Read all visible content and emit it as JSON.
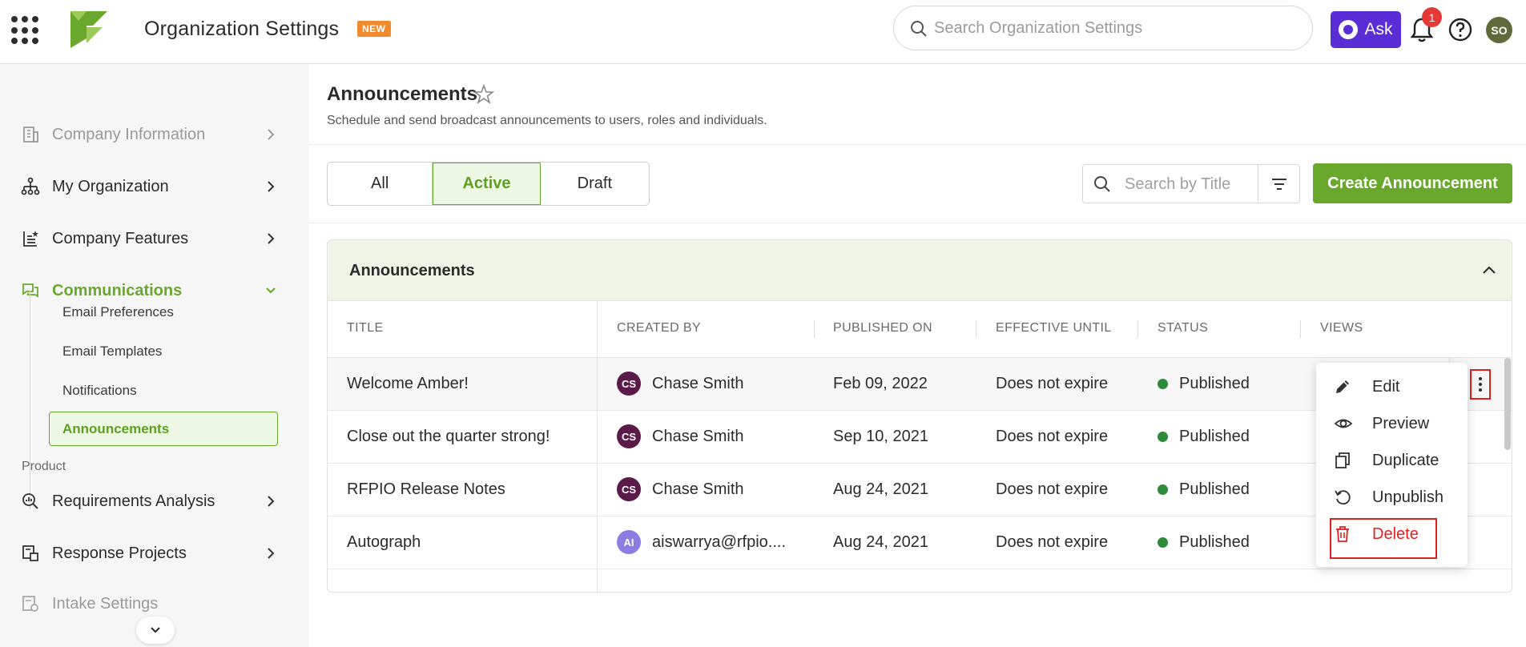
{
  "header": {
    "app_title": "Organization Settings",
    "new_badge": "NEW",
    "search_placeholder": "Search Organization Settings",
    "ask_label": "Ask",
    "notification_count": "1",
    "user_initials": "SO"
  },
  "sidebar": {
    "items": [
      {
        "label": "Company Information"
      },
      {
        "label": "My Organization"
      },
      {
        "label": "Company Features"
      },
      {
        "label": "Communications"
      },
      {
        "label": "Requirements Analysis"
      },
      {
        "label": "Response Projects"
      },
      {
        "label": "Intake Settings"
      }
    ],
    "sub_items": [
      "Email Preferences",
      "Email Templates",
      "Notifications",
      "Announcements"
    ],
    "section_label": "Product"
  },
  "page": {
    "title": "Announcements",
    "subtitle": "Schedule and send broadcast announcements to users, roles and individuals."
  },
  "tabs": [
    "All",
    "Active",
    "Draft"
  ],
  "title_search_placeholder": "Search by Title",
  "create_button": "Create Announcement",
  "card": {
    "title": "Announcements",
    "columns": [
      "TITLE",
      "CREATED BY",
      "PUBLISHED ON",
      "EFFECTIVE UNTIL",
      "STATUS",
      "VIEWS"
    ],
    "rows": [
      {
        "title": "Welcome Amber!",
        "initials": "CS",
        "creator": "Chase Smith",
        "published": "Feb 09, 2022",
        "effective": "Does not expire",
        "status": "Published"
      },
      {
        "title": "Close out the quarter strong!",
        "initials": "CS",
        "creator": "Chase Smith",
        "published": "Sep 10, 2021",
        "effective": "Does not expire",
        "status": "Published"
      },
      {
        "title": "RFPIO Release Notes",
        "initials": "CS",
        "creator": "Chase Smith",
        "published": "Aug 24, 2021",
        "effective": "Does not expire",
        "status": "Published"
      },
      {
        "title": "Autograph",
        "initials": "AI",
        "creator": "aiswarrya@rfpio....",
        "published": "Aug 24, 2021",
        "effective": "Does not expire",
        "status": "Published"
      }
    ]
  },
  "context_menu": [
    "Edit",
    "Preview",
    "Duplicate",
    "Unpublish",
    "Delete"
  ],
  "colors": {
    "accent_green": "#6aa82d",
    "ask_purple": "#5a2dd6",
    "danger_red": "#e02020",
    "avatar_cs": "#5a1a4a",
    "avatar_ai": "#8d7de0",
    "status_green": "#2e8b3a"
  }
}
